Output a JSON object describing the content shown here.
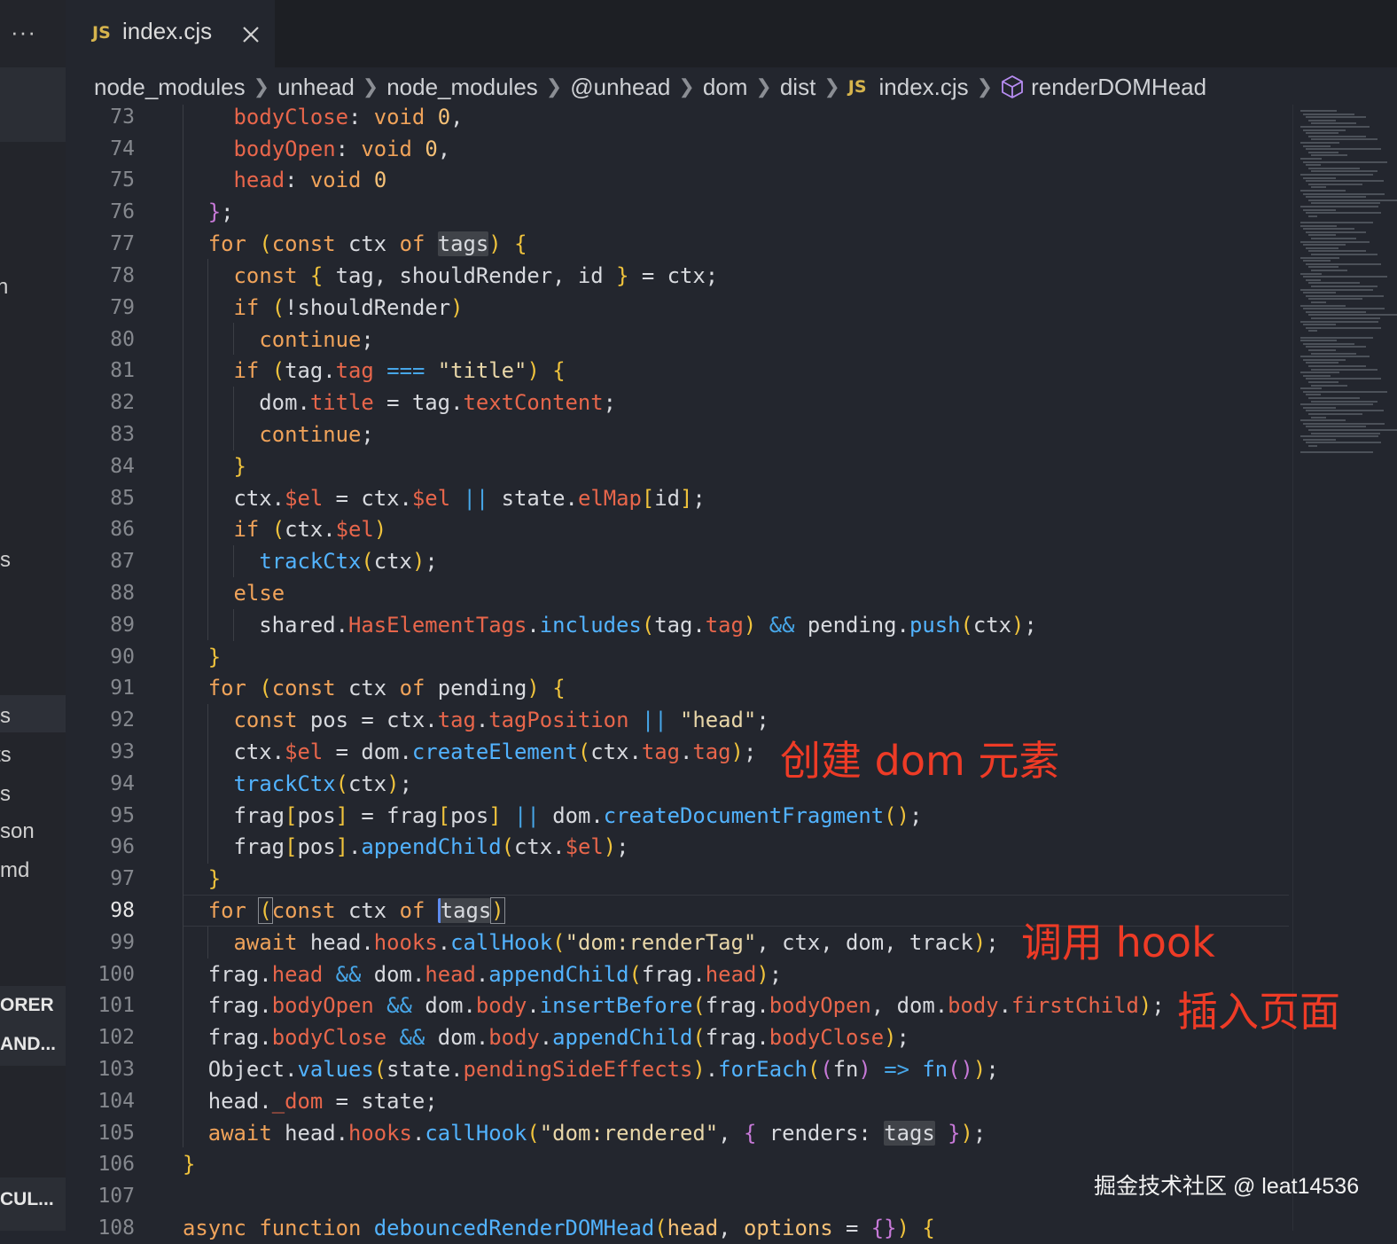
{
  "tab": {
    "icon": "JS",
    "title": "index.cjs",
    "close_icon": "close-icon"
  },
  "sidebar": {
    "more_icon": "···",
    "item_labels": [
      "n",
      "s",
      "s",
      "ts",
      "s",
      "son",
      "md"
    ],
    "sections": [
      "ORER",
      "AND...",
      "CUL..."
    ]
  },
  "breadcrumb": {
    "items": [
      "node_modules",
      "unhead",
      "node_modules",
      "@unhead",
      "dom",
      "dist",
      "index.cjs",
      "renderDOMHead"
    ],
    "file_icon": "JS",
    "symbol_icon": "cube-icon"
  },
  "editor": {
    "active_line": 98,
    "line_numbers": [
      73,
      74,
      75,
      76,
      77,
      78,
      79,
      80,
      81,
      82,
      83,
      84,
      85,
      86,
      87,
      88,
      89,
      90,
      91,
      92,
      93,
      94,
      95,
      96,
      97,
      98,
      99,
      100,
      101,
      102,
      103,
      104,
      105,
      106,
      107,
      108
    ],
    "lines": [
      "    bodyClose: void 0,",
      "    bodyOpen: void 0,",
      "    head: void 0",
      "  };",
      "  for (const ctx of tags) {",
      "    const { tag, shouldRender, id } = ctx;",
      "    if (!shouldRender)",
      "      continue;",
      "    if (tag.tag === \"title\") {",
      "      dom.title = tag.textContent;",
      "      continue;",
      "    }",
      "    ctx.$el = ctx.$el || state.elMap[id];",
      "    if (ctx.$el)",
      "      trackCtx(ctx);",
      "    else",
      "      shared.HasElementTags.includes(tag.tag) && pending.push(ctx);",
      "  }",
      "  for (const ctx of pending) {",
      "    const pos = ctx.tag.tagPosition || \"head\";",
      "    ctx.$el = dom.createElement(ctx.tag.tag);",
      "    trackCtx(ctx);",
      "    frag[pos] = frag[pos] || dom.createDocumentFragment();",
      "    frag[pos].appendChild(ctx.$el);",
      "  }",
      "  for (const ctx of tags)",
      "    await head.hooks.callHook(\"dom:renderTag\", ctx, dom, track);",
      "  frag.head && dom.head.appendChild(frag.head);",
      "  frag.bodyOpen && dom.body.insertBefore(frag.bodyOpen, dom.body.firstChild);",
      "  frag.bodyClose && dom.body.appendChild(frag.bodyClose);",
      "  Object.values(state.pendingSideEffects).forEach((fn) => fn());",
      "  head._dom = state;",
      "  await head.hooks.callHook(\"dom:rendered\", { renders: tags });",
      "}",
      "",
      "async function debouncedRenderDOMHead(head, options = {}) {"
    ]
  },
  "annotations": [
    {
      "text": "创建 dom 元素",
      "color": "#ee3b26"
    },
    {
      "text": "调用 hook",
      "color": "#ee3b26"
    },
    {
      "text": "插入页面",
      "color": "#ee3b26"
    }
  ],
  "watermark": "掘金技术社区 @ leat14536"
}
